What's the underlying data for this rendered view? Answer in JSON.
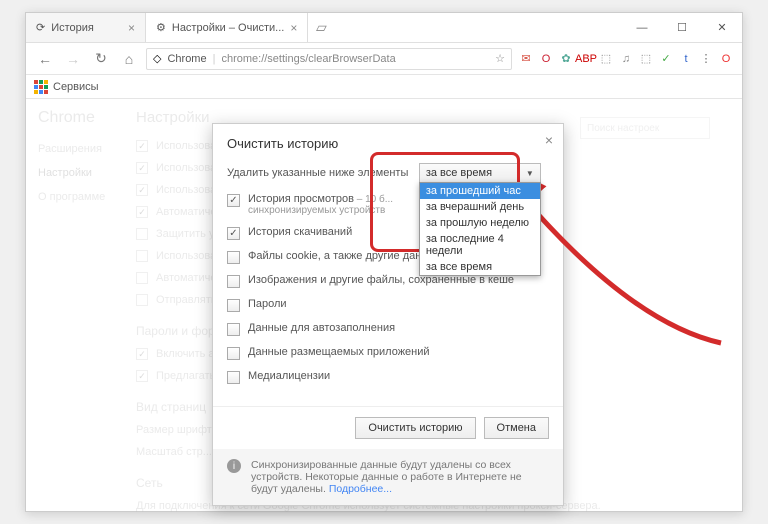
{
  "window": {
    "tabs": [
      {
        "title": "История",
        "icon": "history"
      },
      {
        "title": "Настройки – Очисти...",
        "icon": "gear"
      }
    ],
    "controls": {
      "min": "—",
      "max": "☐",
      "close": "✕"
    }
  },
  "addressbar": {
    "back": "←",
    "forward": "→",
    "reload": "↻",
    "home": "⌂",
    "origin_icon": "◇",
    "origin_label": "Chrome",
    "path": "chrome://settings/clearBrowserData",
    "star": "☆",
    "extensions": [
      "✉",
      "O",
      "✿",
      "ABP",
      "⬚",
      "♫",
      "⬚",
      "✓",
      "t",
      "⋮",
      "O"
    ],
    "ext_colors": [
      "#d54b3d",
      "#c23",
      "#5a9",
      "#c00",
      "#888",
      "#888",
      "#888",
      "#4a4",
      "#36c",
      "#666",
      "#e33"
    ]
  },
  "bookmarks": {
    "label": "Сервисы"
  },
  "settings_bg": {
    "brand": "Chrome",
    "sidebar": [
      "Расширения",
      "Настройки",
      "О программе"
    ],
    "title": "Настройки",
    "search_placeholder": "Поиск настроек",
    "rows": [
      "Использовать...",
      "Использовать...",
      "Использовать...",
      "Автоматически...",
      "Защитить устр...",
      "Использовать...",
      "Автоматически...",
      "Отправлять..."
    ],
    "section_pw": "Пароли и формы",
    "pw_rows": [
      "Включить авт...",
      "Предлагать со..."
    ],
    "section_view": "Вид страниц",
    "view_rows": [
      "Размер шрифта",
      "Масштаб стр..."
    ],
    "section_net": "Сеть",
    "net_text": "Для подключения к сети Google Chrome использует системные настройки прокси-сервера."
  },
  "modal": {
    "title": "Очистить историю",
    "label": "Удалить указанные ниже элементы",
    "select_value": "за все время",
    "options": [
      "за прошедший час",
      "за вчерашний день",
      "за прошлую неделю",
      "за последние 4 недели",
      "за все время"
    ],
    "selected_option_index": 0,
    "items": [
      {
        "checked": true,
        "label": "История просмотров",
        "sub": " – 10 б...",
        "sub2": "синхронизируемых устройств"
      },
      {
        "checked": true,
        "label": "История скачиваний"
      },
      {
        "checked": false,
        "label": "Файлы cookie, а также другие данные сайтов и плагинов"
      },
      {
        "checked": false,
        "label": "Изображения и другие файлы, сохраненные в кеше"
      },
      {
        "checked": false,
        "label": "Пароли"
      },
      {
        "checked": false,
        "label": "Данные для автозаполнения"
      },
      {
        "checked": false,
        "label": "Данные размещаемых приложений"
      },
      {
        "checked": false,
        "label": "Медиалицензии"
      }
    ],
    "btn_clear": "Очистить историю",
    "btn_cancel": "Отмена",
    "sync_note": "Синхронизированные данные будут удалены со всех устройств. Некоторые данные о работе в Интернете не будут удалены. ",
    "sync_link": "Подробнее..."
  }
}
